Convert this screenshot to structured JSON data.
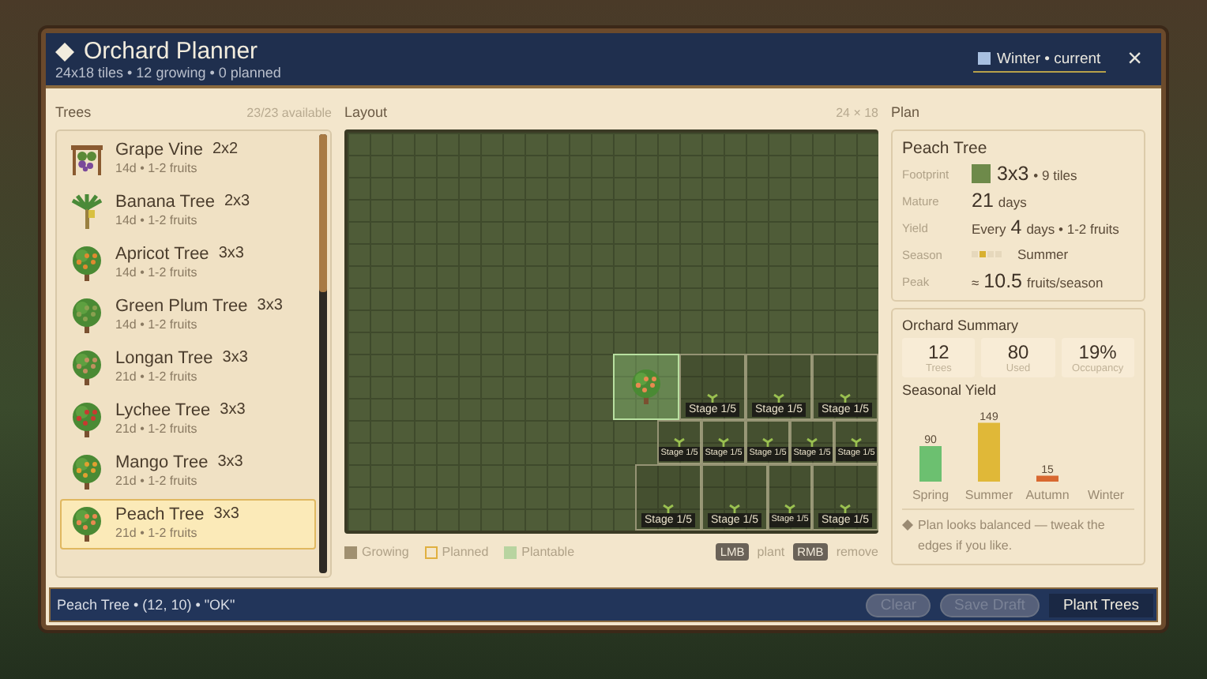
{
  "window": {
    "title": "Orchard Planner",
    "subtitle": "24x18 tiles • 12 growing • 0 planned",
    "season_badge": "Winter • current",
    "close": "×"
  },
  "trees": {
    "heading": "Trees",
    "availability": "23/23 available",
    "items": [
      {
        "name": "Grape Vine",
        "size": "2x2",
        "info": "14d • 1-2 fruits",
        "kind": "vine",
        "color": "#7a4a9a",
        "selected": false
      },
      {
        "name": "Banana Tree",
        "size": "2x3",
        "info": "14d • 1-2 fruits",
        "kind": "banana",
        "color": "#d8c040",
        "selected": false
      },
      {
        "name": "Apricot Tree",
        "size": "3x3",
        "info": "14d • 1-2 fruits",
        "kind": "tree",
        "color": "#e08a30",
        "selected": false
      },
      {
        "name": "Green Plum Tree",
        "size": "3x3",
        "info": "14d • 1-2 fruits",
        "kind": "tree",
        "color": "#8aa050",
        "selected": false
      },
      {
        "name": "Longan Tree",
        "size": "3x3",
        "info": "21d • 1-2 fruits",
        "kind": "tree",
        "color": "#c09060",
        "selected": false
      },
      {
        "name": "Lychee Tree",
        "size": "3x3",
        "info": "21d • 1-2 fruits",
        "kind": "tree",
        "color": "#c83a30",
        "selected": false
      },
      {
        "name": "Mango Tree",
        "size": "3x3",
        "info": "21d • 1-2 fruits",
        "kind": "tree",
        "color": "#e0a030",
        "selected": false
      },
      {
        "name": "Peach Tree",
        "size": "3x3",
        "info": "21d • 1-2 fruits",
        "kind": "tree",
        "color": "#e88a50",
        "selected": true
      }
    ]
  },
  "layout": {
    "heading": "Layout",
    "dimensions": "24 × 18",
    "plots": [
      {
        "label": "Stage 1/5"
      },
      {
        "label": "Stage 1/5"
      },
      {
        "label": "Stage 1/5"
      },
      {
        "label": "Stage 1/5"
      },
      {
        "label": "Stage 1/5"
      },
      {
        "label": "Stage 1/5"
      },
      {
        "label": "Stage 1/5"
      },
      {
        "label": "Stage 1/5"
      },
      {
        "label": "Stage 1/5"
      },
      {
        "label": "Stage 1/5"
      },
      {
        "label": "Stage 1/5"
      },
      {
        "label": "Stage 1/5"
      }
    ],
    "legend": [
      {
        "label": "Growing",
        "kind": "growing"
      },
      {
        "label": "Planned",
        "kind": "planned"
      },
      {
        "label": "Plantable",
        "kind": "plantable"
      }
    ],
    "hints": [
      {
        "key": "LMB",
        "action": "plant"
      },
      {
        "key": "RMB",
        "action": "remove"
      }
    ]
  },
  "plan": {
    "heading": "Plan",
    "tree": "Peach Tree",
    "details": [
      {
        "label": "Footprint",
        "kind": "footprint",
        "main": "3x3",
        "rest": "• 9 tiles"
      },
      {
        "label": "Mature",
        "kind": "text",
        "main": "21",
        "rest": "days"
      },
      {
        "label": "Yield",
        "kind": "text",
        "pre": "Every",
        "main": "4",
        "rest": "days • 1-2 fruits"
      },
      {
        "label": "Season",
        "kind": "season",
        "seasons": [
          {
            "selected": false
          },
          {
            "selected": true
          },
          {
            "selected": false
          },
          {
            "selected": false
          }
        ],
        "rest": "Summer"
      },
      {
        "label": "Peak",
        "kind": "text",
        "pre": "≈",
        "main": "10.5",
        "rest": "fruits/season"
      }
    ],
    "summary": {
      "heading": "Orchard Summary",
      "stats": [
        {
          "value": "12",
          "label": "Trees"
        },
        {
          "value": "80",
          "label": "Used"
        },
        {
          "value": "19%",
          "label": "Occupancy"
        }
      ],
      "chart_title": "Seasonal Yield",
      "chart_data": {
        "type": "bar",
        "categories": [
          "Spring",
          "Summer",
          "Autumn",
          "Winter"
        ],
        "values": [
          90,
          149,
          15,
          null
        ],
        "data_labels": true
      },
      "note": "Plan looks balanced — tweak the edges if you like."
    }
  },
  "status_bar": {
    "text": "Peach Tree • (12, 10) • \"OK\"",
    "buttons": [
      {
        "label": "Clear",
        "disabled": true
      },
      {
        "label": "Save Draft",
        "disabled": true
      },
      {
        "label": "Plant Trees",
        "disabled": false
      }
    ]
  }
}
